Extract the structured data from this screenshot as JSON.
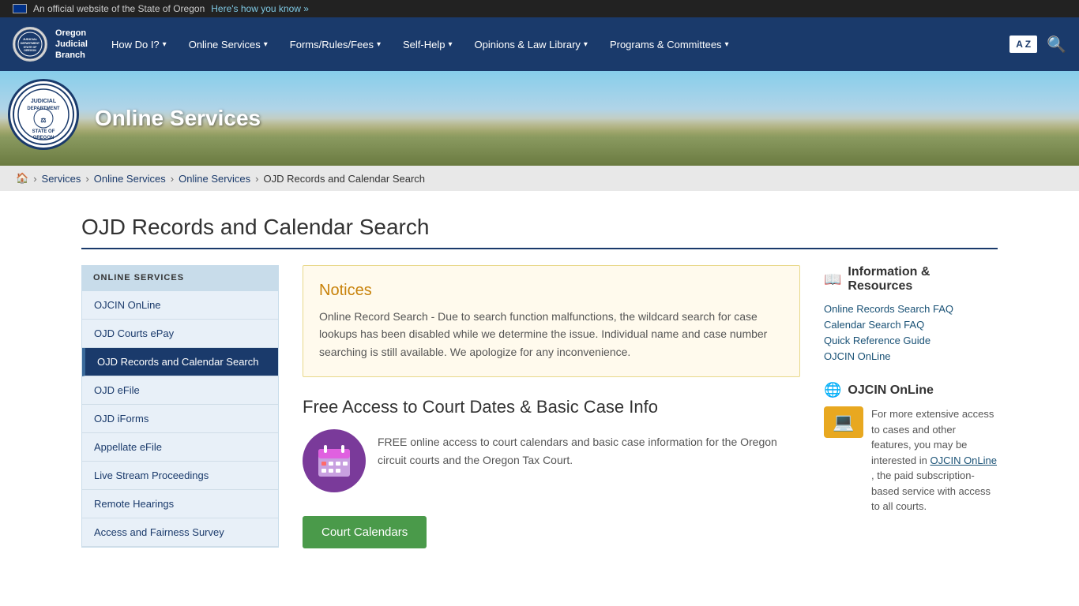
{
  "topBanner": {
    "text": "An official website of the State of Oregon",
    "linkText": "Here's how you know »"
  },
  "nav": {
    "logoLine1": "Oregon",
    "logoLine2": "Judicial",
    "logoLine3": "Branch",
    "items": [
      {
        "label": "How Do I?",
        "hasDropdown": true
      },
      {
        "label": "Online Services",
        "hasDropdown": true
      },
      {
        "label": "Forms/Rules/Fees",
        "hasDropdown": true
      },
      {
        "label": "Self-Help",
        "hasDropdown": true
      },
      {
        "label": "Opinions & Law Library",
        "hasDropdown": true
      },
      {
        "label": "Programs & Committees",
        "hasDropdown": true
      }
    ],
    "translate": "A Z",
    "searchLabel": "🔍"
  },
  "hero": {
    "title": "Online Services",
    "sealText": "JUDICIAL DEPARTMENT STATE OF OREGON"
  },
  "breadcrumb": {
    "home": "🏠",
    "items": [
      {
        "label": "Services",
        "href": "#"
      },
      {
        "label": "Online Services",
        "href": "#"
      },
      {
        "label": "Online Services",
        "href": "#"
      },
      {
        "label": "OJD Records and Calendar Search",
        "href": "#"
      }
    ]
  },
  "pageTitle": "OJD Records and Calendar Search",
  "sidebar": {
    "heading": "ONLINE SERVICES",
    "links": [
      {
        "label": "OJCIN OnLine",
        "active": false
      },
      {
        "label": "OJD Courts ePay",
        "active": false
      },
      {
        "label": "OJD Records and Calendar Search",
        "active": true
      },
      {
        "label": "OJD eFile",
        "active": false
      },
      {
        "label": "OJD iForms",
        "active": false
      },
      {
        "label": "Appellate eFile",
        "active": false
      },
      {
        "label": "Live Stream Proceedings",
        "active": false
      },
      {
        "label": "Remote Hearings",
        "active": false
      },
      {
        "label": "Access and Fairness Survey",
        "active": false
      }
    ]
  },
  "notice": {
    "title": "Notices",
    "text": "Online Record Search - Due to search function malfunctions, the wildcard search for case lookups has been disabled while we determine the issue. Individual name and case number searching is still available. We apologize for any inconvenience."
  },
  "freeAccess": {
    "heading": "Free Access to Court Dates & Basic Case Info",
    "text": "FREE online access to court calendars and basic case information for the Oregon circuit courts and the Oregon Tax Court.",
    "buttonLabel": "Court Calendars",
    "calendarEmoji": "📅"
  },
  "rightSidebar": {
    "infoTitle": "Information & Resources",
    "infoIcon": "📖",
    "links": [
      "Online Records Search FAQ",
      "Calendar Search FAQ",
      "Quick Reference Guide",
      "OJCIN OnLine"
    ],
    "ojcinTitle": "OJCIN OnLine",
    "globeIcon": "🌐",
    "laptopIcon": "💻",
    "ojcinText": "For more extensive access to cases and other features, you may be interested in",
    "ojcinLinkText": "OJCIN OnLine",
    "ojcinText2": ", the paid subscription-based service with access to all courts."
  }
}
